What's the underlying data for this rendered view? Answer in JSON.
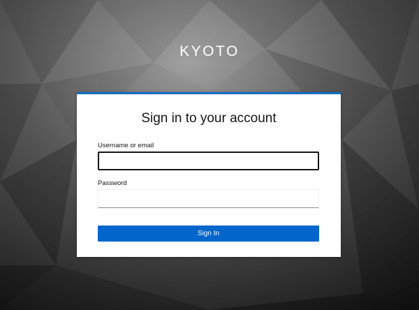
{
  "realm": {
    "title": "KYOTO"
  },
  "login": {
    "heading": "Sign in to your account",
    "username_label": "Username or email",
    "username_value": "",
    "password_label": "Password",
    "password_value": "",
    "submit_label": "Sign In"
  },
  "colors": {
    "accent": "#0066cc",
    "card_border": "#0f6fc5",
    "background": "#2a2a2a"
  }
}
